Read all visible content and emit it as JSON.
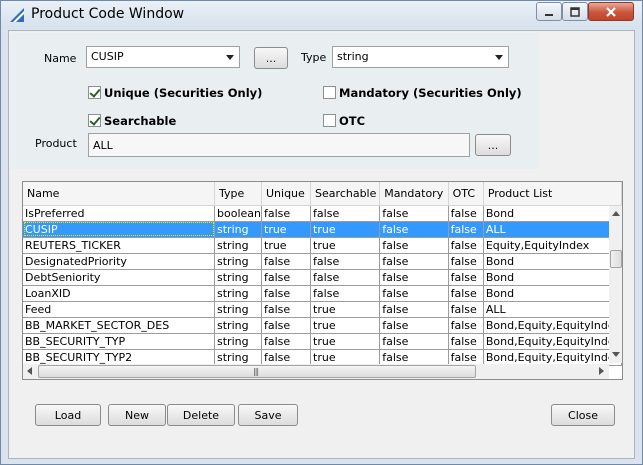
{
  "window": {
    "title": "Product Code  Window"
  },
  "form": {
    "name_label": "Name",
    "name_value": "CUSIP",
    "name_browse": "...",
    "type_label": "Type",
    "type_value": "string",
    "unique_label": "Unique (Securities Only)",
    "unique_checked": true,
    "mandatory_label": "Mandatory (Securities Only)",
    "mandatory_checked": false,
    "searchable_label": "Searchable",
    "searchable_checked": true,
    "otc_label": "OTC",
    "otc_checked": false,
    "product_label": "Product",
    "product_value": "ALL",
    "product_browse": "..."
  },
  "table": {
    "columns": [
      "Name",
      "Type",
      "Unique",
      "Searchable",
      "Mandatory",
      "OTC",
      "Product List"
    ],
    "selected_row": 1,
    "rows": [
      [
        "IsPreferred",
        "boolean",
        "false",
        "false",
        "false",
        "false",
        "Bond"
      ],
      [
        "CUSIP",
        "string",
        "true",
        "true",
        "false",
        "false",
        "ALL"
      ],
      [
        "REUTERS_TICKER",
        "string",
        "true",
        "true",
        "false",
        "false",
        "Equity,EquityIndex"
      ],
      [
        "DesignatedPriority",
        "string",
        "false",
        "false",
        "false",
        "false",
        "Bond"
      ],
      [
        "DebtSeniority",
        "string",
        "false",
        "false",
        "false",
        "false",
        "Bond"
      ],
      [
        "LoanXID",
        "string",
        "false",
        "false",
        "false",
        "false",
        "Bond"
      ],
      [
        "Feed",
        "string",
        "false",
        "true",
        "false",
        "false",
        "ALL"
      ],
      [
        "BB_MARKET_SECTOR_DES",
        "string",
        "false",
        "true",
        "false",
        "false",
        "Bond,Equity,EquityIndex"
      ],
      [
        "BB_SECURITY_TYP",
        "string",
        "false",
        "true",
        "false",
        "false",
        "Bond,Equity,EquityIndex"
      ],
      [
        "BB_SECURITY_TYP2",
        "string",
        "false",
        "true",
        "false",
        "false",
        "Bond,Equity,EquityIndex"
      ]
    ]
  },
  "buttons": {
    "load": "Load",
    "new": "New",
    "delete": "Delete",
    "save": "Save",
    "close": "Close"
  },
  "colors": {
    "selection": "#3399ff",
    "close_button": "#c9563b"
  }
}
